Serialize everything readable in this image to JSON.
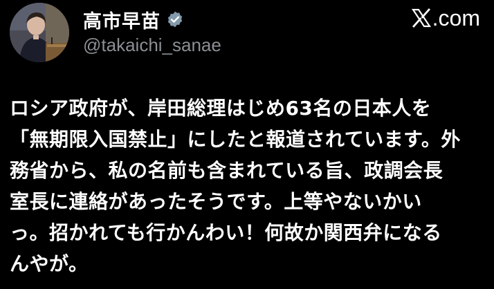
{
  "post": {
    "author": {
      "display_name": "高市早苗",
      "handle": "@takaichi_sanae",
      "verified": true,
      "avatar_icon": "person-avatar"
    },
    "brand": {
      "logo_icon": "x-logo-icon",
      "domain": ".com"
    },
    "body_lines": [
      "ロシア政府が、岸田総理はじめ63名の日本人を",
      "「無期限入国禁止」にしたと報道されています。外",
      "務省から、私の名前も含まれている旨、政調会長",
      "室長に連絡があったそうです。上等やないかい",
      "っ。招かれても行かんわい！何故か関西弁になる",
      "んやが。"
    ]
  },
  "colors": {
    "background": "#000000",
    "text_primary": "#ffffff",
    "text_secondary": "#8b8f94",
    "verified_badge": "#829aab"
  }
}
